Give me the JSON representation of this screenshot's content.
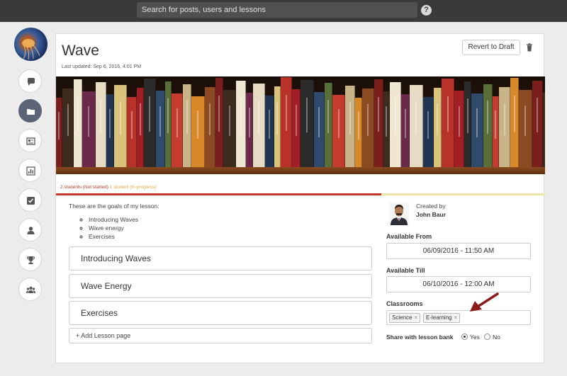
{
  "topbar": {
    "search_placeholder": "Search for posts, users and lessons",
    "help_icon": "question-circle-icon"
  },
  "sidebar": {
    "items": [
      {
        "name": "comments",
        "icon": "chat-bubble-icon"
      },
      {
        "name": "lessons",
        "icon": "folder-icon",
        "active": true
      },
      {
        "name": "news",
        "icon": "newspaper-icon"
      },
      {
        "name": "reports",
        "icon": "bar-chart-icon"
      },
      {
        "name": "tasks",
        "icon": "checkbox-icon"
      },
      {
        "name": "users",
        "icon": "user-icon"
      },
      {
        "name": "achievements",
        "icon": "trophy-icon"
      },
      {
        "name": "groups",
        "icon": "group-icon"
      }
    ]
  },
  "lesson": {
    "title": "Wave",
    "last_updated": "Last updated: Sep 6, 2016, 4:01 PM",
    "revert_label": "Revert to Draft",
    "status_not_started": "2 students (Not started)",
    "status_in_progress": "1 student (In progress)",
    "progress_fraction": 0.665,
    "goals_intro": "These are the goals of my lesson:",
    "goals": [
      "Introducing Waves",
      "Wave energy",
      "Exercises"
    ],
    "pages": [
      "Introducing Waves",
      "Wave Energy",
      "Exercises"
    ],
    "add_page_label": "+ Add Lesson page"
  },
  "details": {
    "created_by_label": "Created by",
    "author_name": "John Baur",
    "available_from_label": "Available From",
    "available_from_value": "06/09/2016 - 11:50 AM",
    "available_till_label": "Available Till",
    "available_till_value": "06/10/2016 - 12:00 AM",
    "classrooms_label": "Classrooms",
    "classrooms": [
      "Science",
      "E-learning"
    ],
    "share_label": "Share with lesson bank",
    "share_yes": "Yes",
    "share_no": "No",
    "share_selected": "Yes"
  },
  "colors": {
    "topbar": "#3a3a3a",
    "active_nav": "#5b6477",
    "not_started": "#c0392b",
    "in_progress": "#e0a93a",
    "arrow": "#8b1a1a"
  }
}
